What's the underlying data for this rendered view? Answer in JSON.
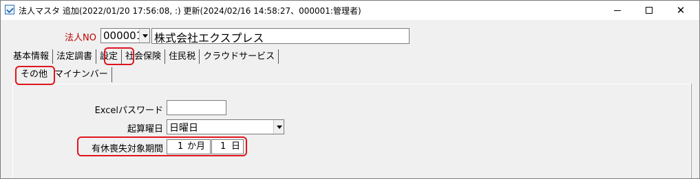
{
  "window": {
    "title": "法人マスタ 追加(2022/01/20 17:56:08, :) 更新(2024/02/16 14:58:27、000001:管理者)",
    "controls": {
      "minimize": "—",
      "maximize": "☐",
      "close": "✕"
    }
  },
  "header": {
    "company_no_label": "法人NO",
    "company_no_value": "000001",
    "company_name": "株式会社エクスプレス"
  },
  "tabs": [
    {
      "label": "基本情報"
    },
    {
      "label": "法定調書"
    },
    {
      "label": "設定"
    },
    {
      "label": "社会保険"
    },
    {
      "label": "住民税"
    },
    {
      "label": "クラウドサービス"
    }
  ],
  "subtabs": [
    {
      "label": "その他"
    },
    {
      "label": "マイナンバー"
    }
  ],
  "form": {
    "excel_password_label": "Excelパスワード",
    "excel_password_value": "",
    "start_weekday_label": "起算曜日",
    "start_weekday_value": "日曜日",
    "leave_expiry_label": "有休喪失対象期間",
    "months_value": "1",
    "months_unit": "か月",
    "days_value": "1",
    "days_unit": "日"
  },
  "highlight_color": "#e0141e"
}
